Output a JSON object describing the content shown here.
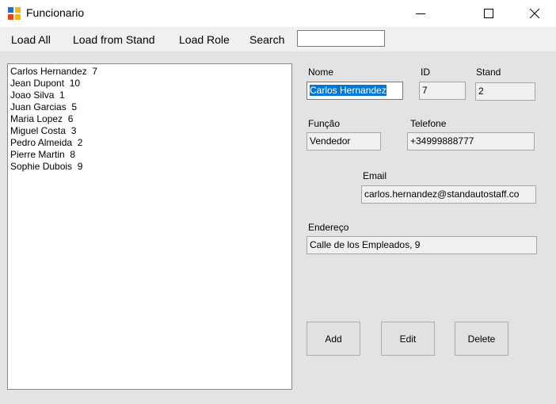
{
  "window": {
    "title": "Funcionario"
  },
  "menu": {
    "load_all": "Load All",
    "load_from_stand": "Load from Stand",
    "load_role": "Load Role",
    "search_label": "Search",
    "search_value": ""
  },
  "employees": [
    {
      "name": "Carlos Hernandez",
      "id": "7"
    },
    {
      "name": "Jean Dupont",
      "id": "10"
    },
    {
      "name": "Joao Silva",
      "id": "1"
    },
    {
      "name": "Juan Garcias",
      "id": "5"
    },
    {
      "name": "Maria Lopez",
      "id": "6"
    },
    {
      "name": "Miguel Costa",
      "id": "3"
    },
    {
      "name": "Pedro Almeida",
      "id": "2"
    },
    {
      "name": "Pierre Martin",
      "id": "8"
    },
    {
      "name": "Sophie Dubois",
      "id": "9"
    }
  ],
  "form": {
    "nome_label": "Nome",
    "nome_value": "Carlos Hernandez",
    "id_label": "ID",
    "id_value": "7",
    "stand_label": "Stand",
    "stand_value": "2",
    "funcao_label": "Função",
    "funcao_value": "Vendedor",
    "telefone_label": "Telefone",
    "telefone_value": "+34999888777",
    "email_label": "Email",
    "email_value": "carlos.hernandez@standautostaff.co",
    "endereco_label": "Endereço",
    "endereco_value": "Calle de los Empleados, 9"
  },
  "actions": {
    "add": "Add",
    "edit": "Edit",
    "delete": "Delete"
  }
}
